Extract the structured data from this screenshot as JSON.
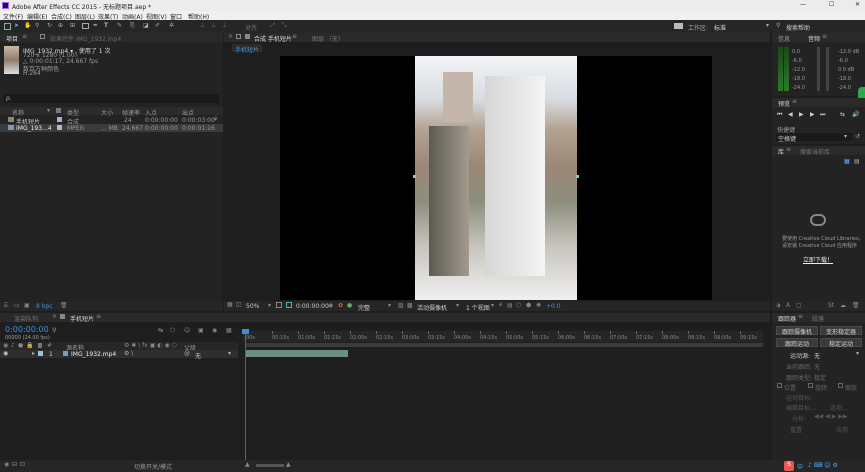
{
  "app": {
    "title": "Adobe After Effects CC 2015 - 无标题项目.aep *",
    "window_controls": [
      "—",
      "☐",
      "✕"
    ]
  },
  "menu": [
    "文件(F)",
    "编辑(E)",
    "合成(C)",
    "图层(L)",
    "效果(T)",
    "动画(A)",
    "视图(V)",
    "窗口",
    "帮助(H)"
  ],
  "toolbar": {
    "snap_label": "对齐",
    "workspace_label": "工作区:",
    "workspace_value": "标准",
    "search_placeholder": "搜索帮助"
  },
  "project": {
    "tab_label": "项目",
    "effects_tab_label": "效果控件 IMG_1932.mp4",
    "file_name": "IMG_1932.mp4 ▾ , 使用了 1 次",
    "file_info_1": "720 x 1280 (1.00)",
    "file_info_2": "△ 0:00:01:17, 24.667 fps",
    "file_info_3": "数百万种颜色",
    "file_info_4": "H.264",
    "search_placeholder": "ρ.",
    "columns": [
      "名称",
      "类型",
      "大小",
      "帧速率",
      "入点",
      "出点"
    ],
    "rows": [
      {
        "name": "手机短片",
        "type": "合成",
        "size": "",
        "fps": "24",
        "in": "0:00:00:00",
        "out": "0:00:03:00"
      },
      {
        "name": "IMG_193...4",
        "type": "MPEG",
        "size": "... MB",
        "fps": "24.667",
        "in": "0:00:00:00",
        "out": "0:00:01:16"
      }
    ],
    "bpc": "8 bpc"
  },
  "composition": {
    "tab_label": "合成 手机短片",
    "layer_tab_label": "图层 （无）",
    "breadcrumb": "手机短片",
    "zoom": "50%",
    "timecode": "0:00:00:00",
    "resolution": "完整",
    "camera": "活动摄像机",
    "views": "1 个视图",
    "exposure": "+0.0"
  },
  "info_panel": {
    "tab_info": "信息",
    "tab_audio": "音频",
    "levels_left": [
      "0.0",
      "-6.0",
      "-12.0",
      "-18.0",
      "-24.0"
    ],
    "levels_right": [
      "-12.0 dB",
      "-6.0",
      "0.0 dB",
      "-18.0",
      "-24.0"
    ]
  },
  "preview_panel": {
    "tab_label": "预览",
    "shortcut_label": "快捷键",
    "shortcut_value": "空格键"
  },
  "libraries_panel": {
    "tab_label": "库",
    "search_placeholder": "搜索当前库",
    "message_1": "要使用 Creative Cloud Libraries，",
    "message_2": "请安装 Creative Cloud 应用程序",
    "link": "立即下载！"
  },
  "timeline": {
    "render_tab": "渲染队列",
    "comp_tab": "手机短片",
    "timecode": "0:00:00:00",
    "fps_info": "00000 (24.00 fps)",
    "columns": [
      "源名称",
      "父级"
    ],
    "layer_number": "1",
    "layer_name": "IMG_1932.mp4",
    "layer_parent": "无",
    "ruler": [
      "00s",
      "00:15s",
      "01:00s",
      "01:15s",
      "02:00s",
      "02:15s",
      "03:00s",
      "03:15s",
      "04:00s",
      "04:15s",
      "05:00s",
      "05:15s",
      "06:00s",
      "06:15s",
      "07:00s",
      "07:15s",
      "08:00s",
      "08:15s",
      "09:00s",
      "09:15s"
    ],
    "toggle_label": "切换开关/模式"
  },
  "tracker": {
    "tab_label": "跟踪器",
    "tab2_label": "段落",
    "btn_camera": "跟踪摄像机",
    "btn_warp": "变形稳定器",
    "btn_motion": "跟踪运动",
    "btn_stabilize": "稳定运动",
    "source_label": "运动源:",
    "source_value": "无",
    "current_track_label": "当前跟踪:",
    "current_track_value": "无",
    "track_type_label": "跟踪类型:",
    "track_type_value": "稳定",
    "position": "位置",
    "rotation": "旋转",
    "scale": "缩放",
    "motion_target": "运动目标:",
    "edit_target": "编辑目标...",
    "options": "选项...",
    "analyze": "分析:",
    "reset": "重置",
    "apply": "应用"
  },
  "taskbar": {
    "ime": "中",
    "tray": "♪ ⌨ ☺ ⚙"
  }
}
